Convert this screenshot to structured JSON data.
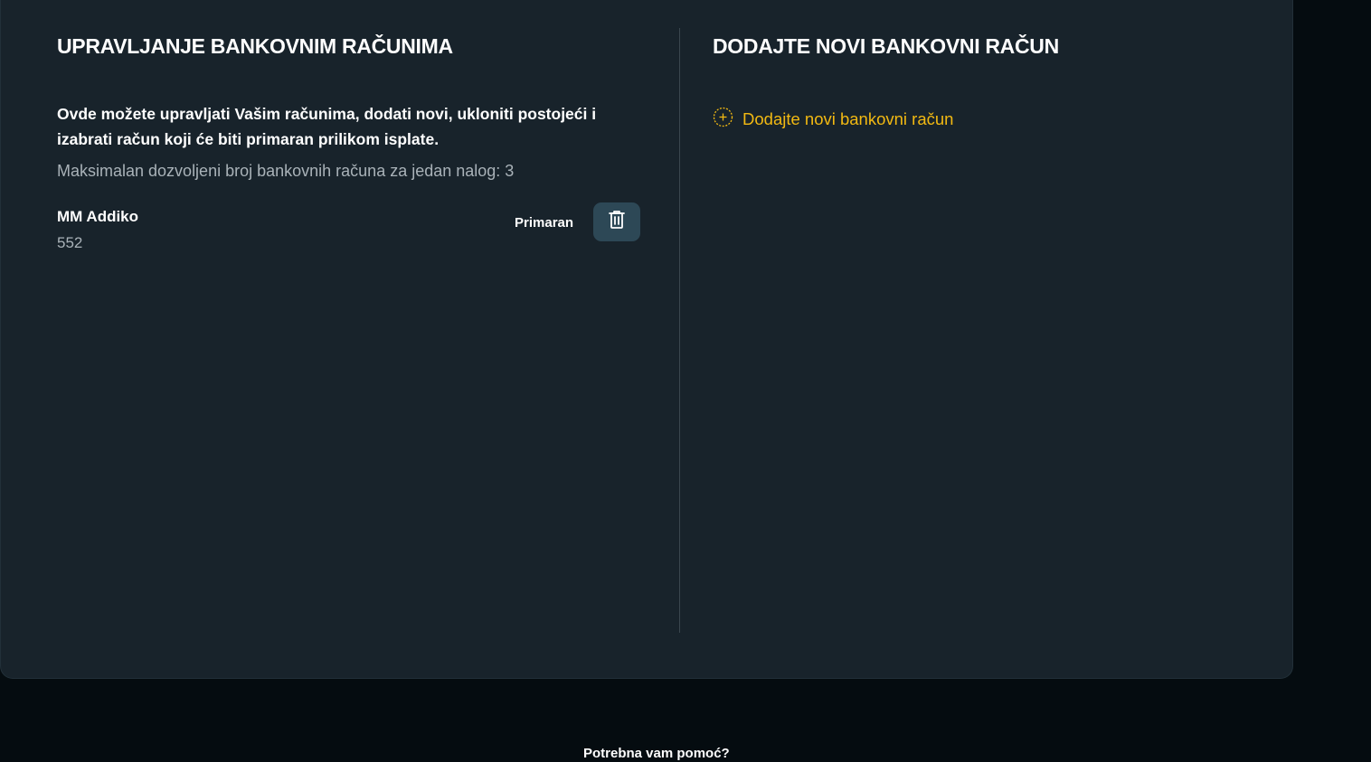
{
  "manage": {
    "title": "UPRAVLJANJE BANKOVNIM RAČUNIMA",
    "intro": "Ovde možete upravljati Vašim računima, dodati novi, ukloniti postojeći i izabrati račun koji će biti primaran prilikom isplate.",
    "limit": "Maksimalan dozvoljeni broj bankovnih računa za jedan nalog: 3",
    "accounts": [
      {
        "name": "MM Addiko",
        "number": "552",
        "status": "Primaran",
        "delete_icon": "trash-icon"
      }
    ]
  },
  "add": {
    "title": "DODAJTE NOVI BANKOVNI RAČUN",
    "link_label": "Dodajte novi bankovni račun",
    "link_icon": "plus-circle-icon"
  },
  "footer": {
    "partial_text": "Potrebna vam pomoć?"
  },
  "colors": {
    "background": "#050c10",
    "panel": "#18232b",
    "accent": "#f2b912",
    "button": "#2d4856"
  }
}
